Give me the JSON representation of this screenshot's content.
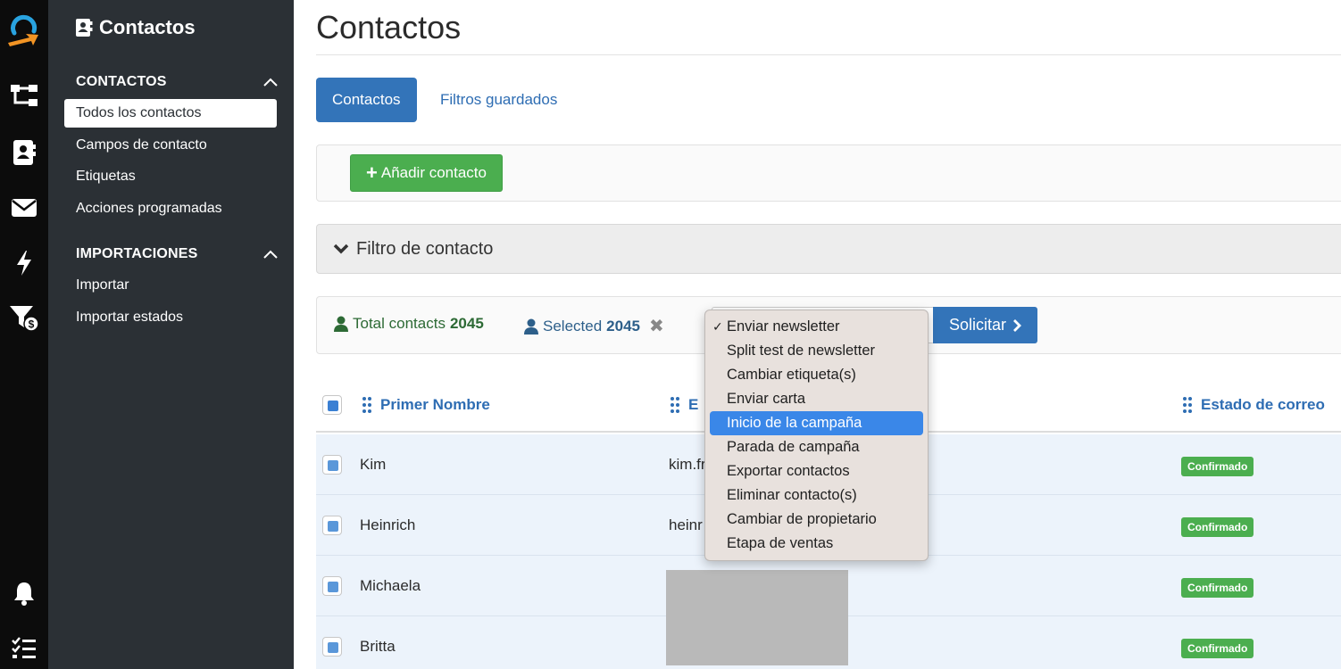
{
  "rail": {
    "icons": [
      "logo-icon",
      "workflow-icon",
      "contacts-card-icon",
      "envelope-icon",
      "lightning-icon",
      "sales-funnel-icon",
      "bell-icon",
      "task-list-icon"
    ]
  },
  "sidebar": {
    "title": "Contactos",
    "sections": [
      {
        "label": "CONTACTOS",
        "items": [
          {
            "label": "Todos los contactos",
            "active": true
          },
          {
            "label": "Campos de contacto"
          },
          {
            "label": "Etiquetas"
          },
          {
            "label": "Acciones programadas"
          }
        ]
      },
      {
        "label": "IMPORTACIONES",
        "items": [
          {
            "label": "Importar"
          },
          {
            "label": "Importar estados"
          }
        ]
      }
    ]
  },
  "main": {
    "title": "Contactos",
    "tabs": [
      {
        "label": "Contactos",
        "active": true
      },
      {
        "label": "Filtros guardados"
      }
    ],
    "add_contact_label": "Añadir contacto",
    "filter_label": "Filtro de contacto",
    "stats": {
      "total_label": "Total contacts",
      "total_value": "2045",
      "selected_label": "Selected",
      "selected_value": "2045"
    },
    "apply_label": "Solicitar",
    "action_menu": {
      "selected": "Enviar newsletter",
      "highlighted": "Inicio de la campaña",
      "options": [
        "Enviar newsletter",
        "Split test de newsletter",
        "Cambiar etiqueta(s)",
        "Enviar carta",
        "Inicio de la campaña",
        "Parada de campaña",
        "Exportar contactos",
        "Eliminar contacto(s)",
        "Cambiar de propietario",
        "Etapa de ventas"
      ]
    },
    "table": {
      "columns": [
        "Primer Nombre",
        "E",
        "Estado de correo"
      ],
      "rows": [
        {
          "first_name": "Kim",
          "email": "kim.fr",
          "status": "Confirmado"
        },
        {
          "first_name": "Heinrich",
          "email": "heinr",
          "status": "Confirmado"
        },
        {
          "first_name": "Michaela",
          "email": "",
          "status": "Confirmado"
        },
        {
          "first_name": "Britta",
          "email": "",
          "status": "Confirmado"
        }
      ]
    }
  },
  "colors": {
    "primary": "#3374b9",
    "success": "#4bae4f",
    "sidebar_bg": "#2b3035",
    "rail_bg": "#0c0c0c",
    "highlight": "#3a87e8",
    "logo_blue": "#29a3e0",
    "logo_orange": "#f29424"
  }
}
